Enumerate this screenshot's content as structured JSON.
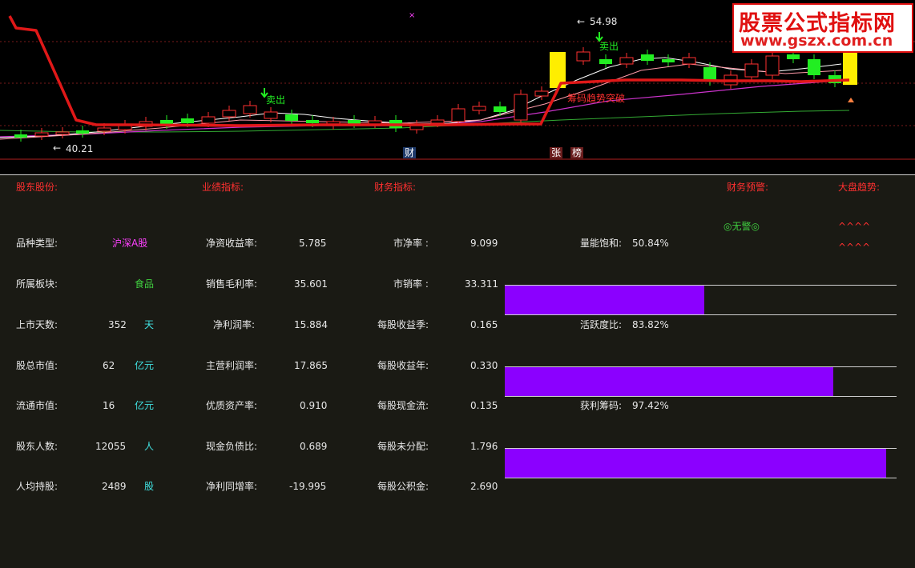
{
  "chart": {
    "price_high": "54.98",
    "price_low": "40.21",
    "sell_label_1": "卖出",
    "sell_label_2": "卖出",
    "breakout_label": "筹码趋势突破",
    "marker_cai": "财",
    "marker_zhang": "张",
    "marker_bang": "榜",
    "colors": {
      "trend": "#e01818",
      "up_candle": "#ff3030",
      "down_candle": "#22ee22",
      "highlight": "#ffee00",
      "ma_white": "#ffffff",
      "ma_magenta": "#cc33cc",
      "ma_green": "#33aa33"
    }
  },
  "watermark": {
    "title": "股票公式指标网",
    "url": "www.gszx.com.cn"
  },
  "sections": {
    "shareholders": "股东股份:",
    "performance": "业绩指标:",
    "finance": "财务指标:",
    "warning": "财务预警:",
    "market_trend": "大盘趋势:"
  },
  "warning_status": "◎无警◎",
  "market_trend_arrows": [
    "^^^^",
    "^^^^"
  ],
  "shareholder_rows": [
    {
      "label": "品种类型:",
      "value": "",
      "unit": "沪深A股"
    },
    {
      "label": "所属板块:",
      "value": "",
      "unit": "食品"
    },
    {
      "label": "上市天数:",
      "value": "352",
      "unit": "天"
    },
    {
      "label": "股总市值:",
      "value": "62",
      "unit": "亿元"
    },
    {
      "label": "流通市值:",
      "value": "16",
      "unit": "亿元"
    },
    {
      "label": "股东人数:",
      "value": "12055",
      "unit": "人"
    },
    {
      "label": "人均持股:",
      "value": "2489",
      "unit": "股"
    }
  ],
  "performance_rows": [
    {
      "label": "净资收益率:",
      "value": "5.785"
    },
    {
      "label": "销售毛利率:",
      "value": "35.601"
    },
    {
      "label": "净利润率:",
      "value": "15.884"
    },
    {
      "label": "主营利润率:",
      "value": "17.865"
    },
    {
      "label": "优质资产率:",
      "value": "0.910"
    },
    {
      "label": "现金负债比:",
      "value": "0.689"
    },
    {
      "label": "净利同增率:",
      "value": "-19.995"
    }
  ],
  "finance_rows": [
    {
      "label": "市净率 :",
      "value": "9.099"
    },
    {
      "label": "市销率 :",
      "value": "33.311"
    },
    {
      "label": "每股收益季:",
      "value": "0.165"
    },
    {
      "label": "每股收益年:",
      "value": "0.330"
    },
    {
      "label": "每股现金流:",
      "value": "0.135"
    },
    {
      "label": "每股未分配:",
      "value": "1.796"
    },
    {
      "label": "每股公积金:",
      "value": "2.690"
    }
  ],
  "gauges": [
    {
      "label": "量能饱和:",
      "value": "50.84%",
      "fraction": 0.5084
    },
    {
      "label": "活跃度比:",
      "value": "83.82%",
      "fraction": 0.8382
    },
    {
      "label": "获利筹码:",
      "value": "97.42%",
      "fraction": 0.9742
    }
  ]
}
